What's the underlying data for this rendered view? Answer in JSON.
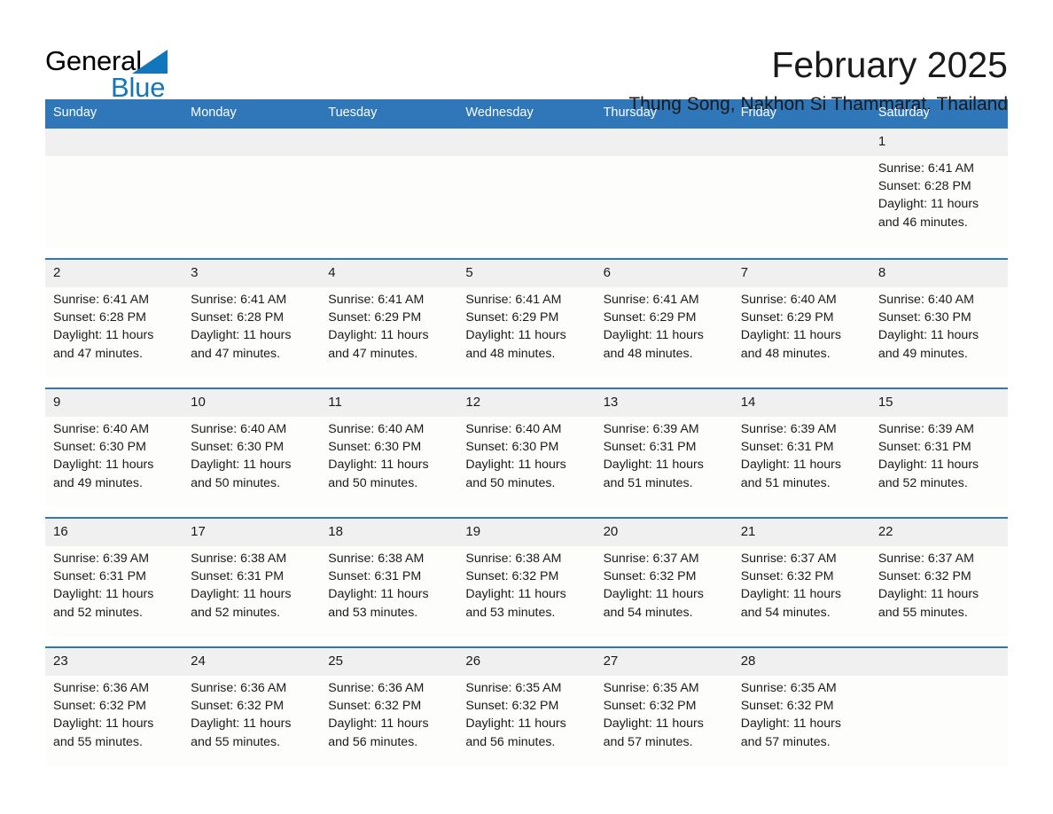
{
  "brand": {
    "name_part1": "General",
    "name_part2": "Blue",
    "accent_color": "#1276bc",
    "triangle_icon": "triangle-icon"
  },
  "header": {
    "title": "February 2025",
    "subtitle": "Thung Song, Nakhon Si Thammarat, Thailand"
  },
  "calendar": {
    "header_bg": "#2f77b8",
    "daynum_bg": "#f0f0f0",
    "columns": [
      "Sunday",
      "Monday",
      "Tuesday",
      "Wednesday",
      "Thursday",
      "Friday",
      "Saturday"
    ],
    "weeks": [
      [
        {
          "day": "",
          "info": ""
        },
        {
          "day": "",
          "info": ""
        },
        {
          "day": "",
          "info": ""
        },
        {
          "day": "",
          "info": ""
        },
        {
          "day": "",
          "info": ""
        },
        {
          "day": "",
          "info": ""
        },
        {
          "day": "1",
          "info": "Sunrise: 6:41 AM\nSunset: 6:28 PM\nDaylight: 11 hours\nand 46 minutes."
        }
      ],
      [
        {
          "day": "2",
          "info": "Sunrise: 6:41 AM\nSunset: 6:28 PM\nDaylight: 11 hours\nand 47 minutes."
        },
        {
          "day": "3",
          "info": "Sunrise: 6:41 AM\nSunset: 6:28 PM\nDaylight: 11 hours\nand 47 minutes."
        },
        {
          "day": "4",
          "info": "Sunrise: 6:41 AM\nSunset: 6:29 PM\nDaylight: 11 hours\nand 47 minutes."
        },
        {
          "day": "5",
          "info": "Sunrise: 6:41 AM\nSunset: 6:29 PM\nDaylight: 11 hours\nand 48 minutes."
        },
        {
          "day": "6",
          "info": "Sunrise: 6:41 AM\nSunset: 6:29 PM\nDaylight: 11 hours\nand 48 minutes."
        },
        {
          "day": "7",
          "info": "Sunrise: 6:40 AM\nSunset: 6:29 PM\nDaylight: 11 hours\nand 48 minutes."
        },
        {
          "day": "8",
          "info": "Sunrise: 6:40 AM\nSunset: 6:30 PM\nDaylight: 11 hours\nand 49 minutes."
        }
      ],
      [
        {
          "day": "9",
          "info": "Sunrise: 6:40 AM\nSunset: 6:30 PM\nDaylight: 11 hours\nand 49 minutes."
        },
        {
          "day": "10",
          "info": "Sunrise: 6:40 AM\nSunset: 6:30 PM\nDaylight: 11 hours\nand 50 minutes."
        },
        {
          "day": "11",
          "info": "Sunrise: 6:40 AM\nSunset: 6:30 PM\nDaylight: 11 hours\nand 50 minutes."
        },
        {
          "day": "12",
          "info": "Sunrise: 6:40 AM\nSunset: 6:30 PM\nDaylight: 11 hours\nand 50 minutes."
        },
        {
          "day": "13",
          "info": "Sunrise: 6:39 AM\nSunset: 6:31 PM\nDaylight: 11 hours\nand 51 minutes."
        },
        {
          "day": "14",
          "info": "Sunrise: 6:39 AM\nSunset: 6:31 PM\nDaylight: 11 hours\nand 51 minutes."
        },
        {
          "day": "15",
          "info": "Sunrise: 6:39 AM\nSunset: 6:31 PM\nDaylight: 11 hours\nand 52 minutes."
        }
      ],
      [
        {
          "day": "16",
          "info": "Sunrise: 6:39 AM\nSunset: 6:31 PM\nDaylight: 11 hours\nand 52 minutes."
        },
        {
          "day": "17",
          "info": "Sunrise: 6:38 AM\nSunset: 6:31 PM\nDaylight: 11 hours\nand 52 minutes."
        },
        {
          "day": "18",
          "info": "Sunrise: 6:38 AM\nSunset: 6:31 PM\nDaylight: 11 hours\nand 53 minutes."
        },
        {
          "day": "19",
          "info": "Sunrise: 6:38 AM\nSunset: 6:32 PM\nDaylight: 11 hours\nand 53 minutes."
        },
        {
          "day": "20",
          "info": "Sunrise: 6:37 AM\nSunset: 6:32 PM\nDaylight: 11 hours\nand 54 minutes."
        },
        {
          "day": "21",
          "info": "Sunrise: 6:37 AM\nSunset: 6:32 PM\nDaylight: 11 hours\nand 54 minutes."
        },
        {
          "day": "22",
          "info": "Sunrise: 6:37 AM\nSunset: 6:32 PM\nDaylight: 11 hours\nand 55 minutes."
        }
      ],
      [
        {
          "day": "23",
          "info": "Sunrise: 6:36 AM\nSunset: 6:32 PM\nDaylight: 11 hours\nand 55 minutes."
        },
        {
          "day": "24",
          "info": "Sunrise: 6:36 AM\nSunset: 6:32 PM\nDaylight: 11 hours\nand 55 minutes."
        },
        {
          "day": "25",
          "info": "Sunrise: 6:36 AM\nSunset: 6:32 PM\nDaylight: 11 hours\nand 56 minutes."
        },
        {
          "day": "26",
          "info": "Sunrise: 6:35 AM\nSunset: 6:32 PM\nDaylight: 11 hours\nand 56 minutes."
        },
        {
          "day": "27",
          "info": "Sunrise: 6:35 AM\nSunset: 6:32 PM\nDaylight: 11 hours\nand 57 minutes."
        },
        {
          "day": "28",
          "info": "Sunrise: 6:35 AM\nSunset: 6:32 PM\nDaylight: 11 hours\nand 57 minutes."
        },
        {
          "day": "",
          "info": ""
        }
      ]
    ]
  }
}
